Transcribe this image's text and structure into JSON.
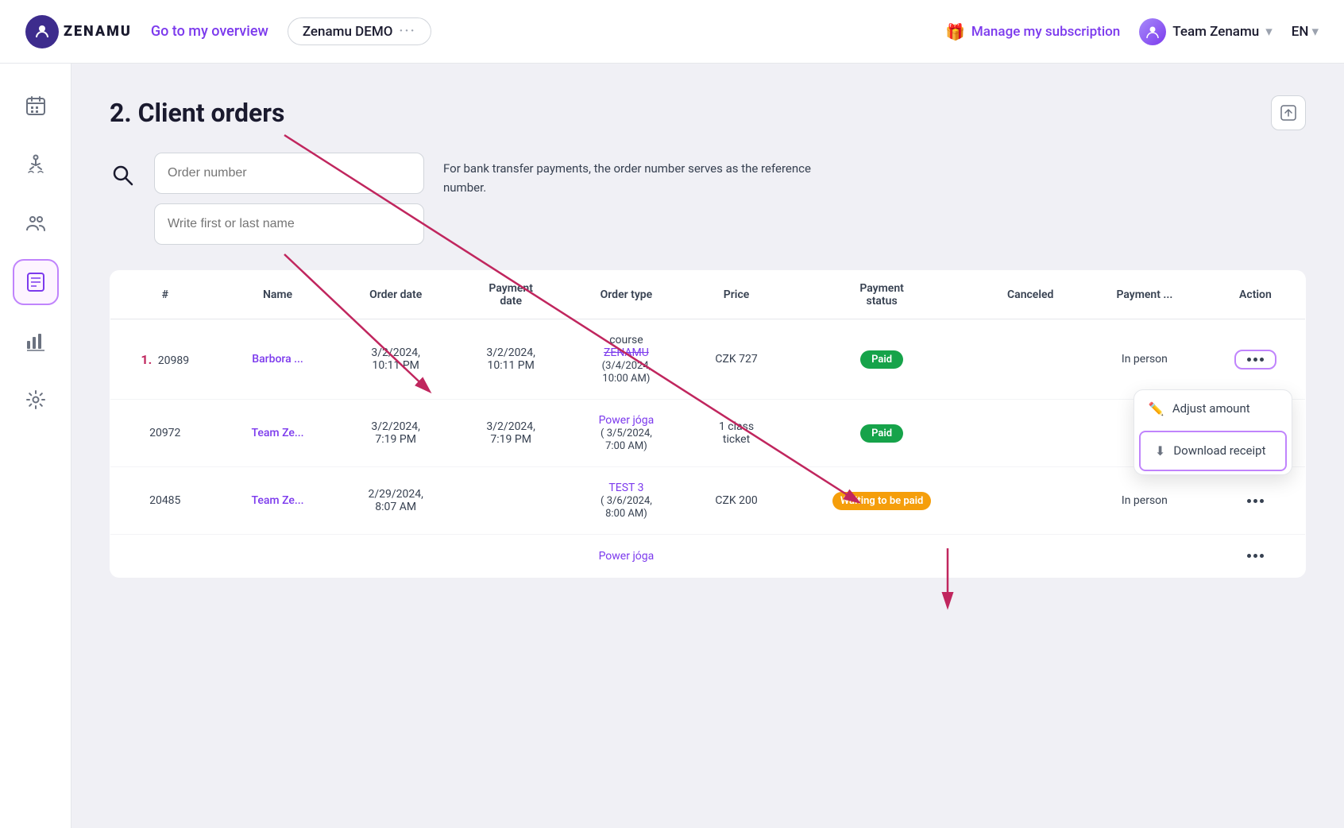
{
  "header": {
    "logo_text": "ZENAMU",
    "nav_link": "Go to my overview",
    "workspace_name": "Zenamu DEMO",
    "workspace_dots": "···",
    "manage_sub": "Manage my subscription",
    "team_name": "Team Zenamu",
    "lang": "EN"
  },
  "sidebar": {
    "items": [
      {
        "id": "calendar",
        "icon": "📅",
        "label": "Calendar"
      },
      {
        "id": "yoga",
        "icon": "🧘",
        "label": "Yoga"
      },
      {
        "id": "clients",
        "icon": "👥",
        "label": "Clients"
      },
      {
        "id": "orders",
        "icon": "📋",
        "label": "Orders",
        "active": true
      },
      {
        "id": "analytics",
        "icon": "📊",
        "label": "Analytics"
      },
      {
        "id": "settings",
        "icon": "⚙️",
        "label": "Settings"
      }
    ]
  },
  "page": {
    "step_num": "2.",
    "title": "Client orders",
    "export_icon": "⊣",
    "search": {
      "order_placeholder": "Order number",
      "name_placeholder": "Write first or last name"
    },
    "bank_info": "For bank transfer payments, the order number serves as the reference\nnumber.",
    "table": {
      "columns": [
        "#",
        "Name",
        "Order date",
        "Payment\ndate",
        "Order type",
        "Price",
        "Payment\nstatus",
        "Canceled",
        "Payment ...",
        "Action"
      ],
      "rows": [
        {
          "step": "1.",
          "id": "20989",
          "name": "Barbora ...",
          "order_date": "3/2/2024,\n10:11 PM",
          "payment_date": "3/2/2024,\n10:11 PM",
          "order_type_label": "course",
          "order_type_link": "ZENAMU",
          "order_type_link_strikethrough": true,
          "order_type_date": "(3/4/2024,\n10:00 AM)",
          "price": "CZK 727",
          "payment_status": "Paid",
          "payment_status_type": "paid",
          "canceled": "",
          "payment_method": "In person",
          "action": "dropdown_open"
        },
        {
          "id": "20972",
          "name": "Team Ze...",
          "order_date": "3/2/2024,\n7:19 PM",
          "payment_date": "3/2/2024,\n7:19 PM",
          "order_type_label": "",
          "order_type_link": "Power jóga",
          "order_type_link_strikethrough": false,
          "order_type_date": "( 3/5/2024,\n7:00 AM)",
          "price": "1 class\nticket",
          "payment_status": "Paid",
          "payment_status_type": "paid",
          "canceled": "",
          "payment_method": "",
          "action": "dots"
        },
        {
          "id": "20485",
          "name": "Team Ze...",
          "order_date": "2/29/2024,\n8:07 AM",
          "payment_date": "",
          "order_type_label": "",
          "order_type_link": "TEST 3",
          "order_type_link_strikethrough": false,
          "order_type_date": "( 3/6/2024,\n8:00 AM)",
          "price": "CZK 200",
          "payment_status": "Waiting to be paid",
          "payment_status_type": "waiting",
          "canceled": "",
          "payment_method": "In person",
          "action": "dots"
        },
        {
          "id": "",
          "name": "",
          "order_date": "",
          "payment_date": "",
          "order_type_label": "",
          "order_type_link": "Power jóga",
          "order_type_link_strikethrough": false,
          "order_type_date": "",
          "price": "",
          "payment_status": "",
          "payment_status_type": "",
          "canceled": "",
          "payment_method": "",
          "action": "dots"
        }
      ]
    },
    "dropdown": {
      "adjust_label": "Adjust amount",
      "download_label": "Download receipt"
    }
  }
}
